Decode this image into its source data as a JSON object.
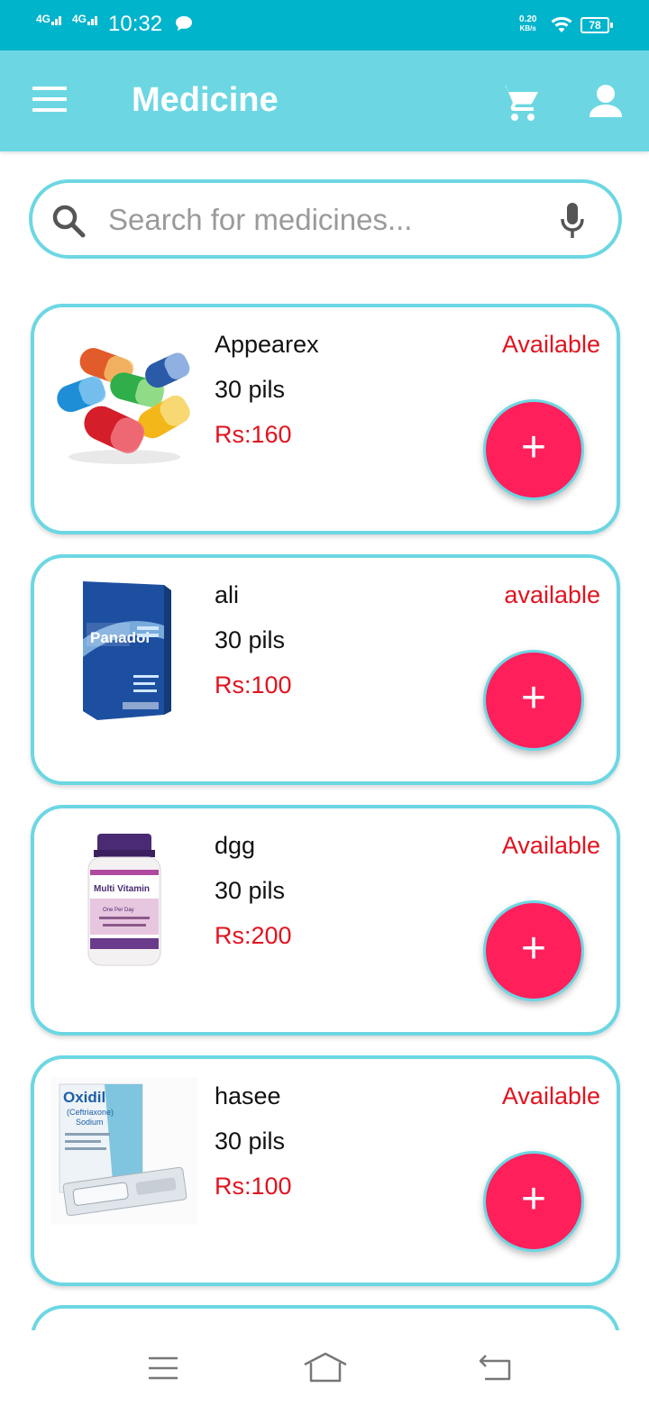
{
  "status_bar": {
    "signal1": "4G",
    "signal2": "4G",
    "time": "10:32",
    "speed_value": "0.20",
    "speed_unit": "KB/s",
    "battery": "78"
  },
  "app_bar": {
    "title": "Medicine",
    "color": "#6cd7e3"
  },
  "search": {
    "placeholder": "Search for medicines..."
  },
  "products": [
    {
      "name": "Appearex",
      "quantity": "30 pils",
      "price": "Rs:160",
      "status": "Available",
      "image_icon": "capsules-image"
    },
    {
      "name": "ali",
      "quantity": "30 pils",
      "price": "Rs:100",
      "status": "available",
      "image_icon": "panadol-box-image"
    },
    {
      "name": "dgg",
      "quantity": "30 pils",
      "price": "Rs:200",
      "status": "Available",
      "image_icon": "multivitamin-bottle-image"
    },
    {
      "name": "hasee",
      "quantity": "30 pils",
      "price": "Rs:100",
      "status": "Available",
      "image_icon": "oxidil-box-image"
    }
  ],
  "add_button_label": "+",
  "colors": {
    "accent": "#6cd7e3",
    "status_bar": "#00b4cc",
    "price_red": "#e2131f",
    "fab_pink": "#ff1f5b"
  },
  "product_image_text": {
    "panadol": "Panadol",
    "multivitamin_title": "Multi Vitamin",
    "multivitamin_sub": "One Per Day",
    "oxidil": "Oxidil",
    "oxidil_sub1": "(Ceftriaxone)",
    "oxidil_sub2": "Sodium"
  }
}
